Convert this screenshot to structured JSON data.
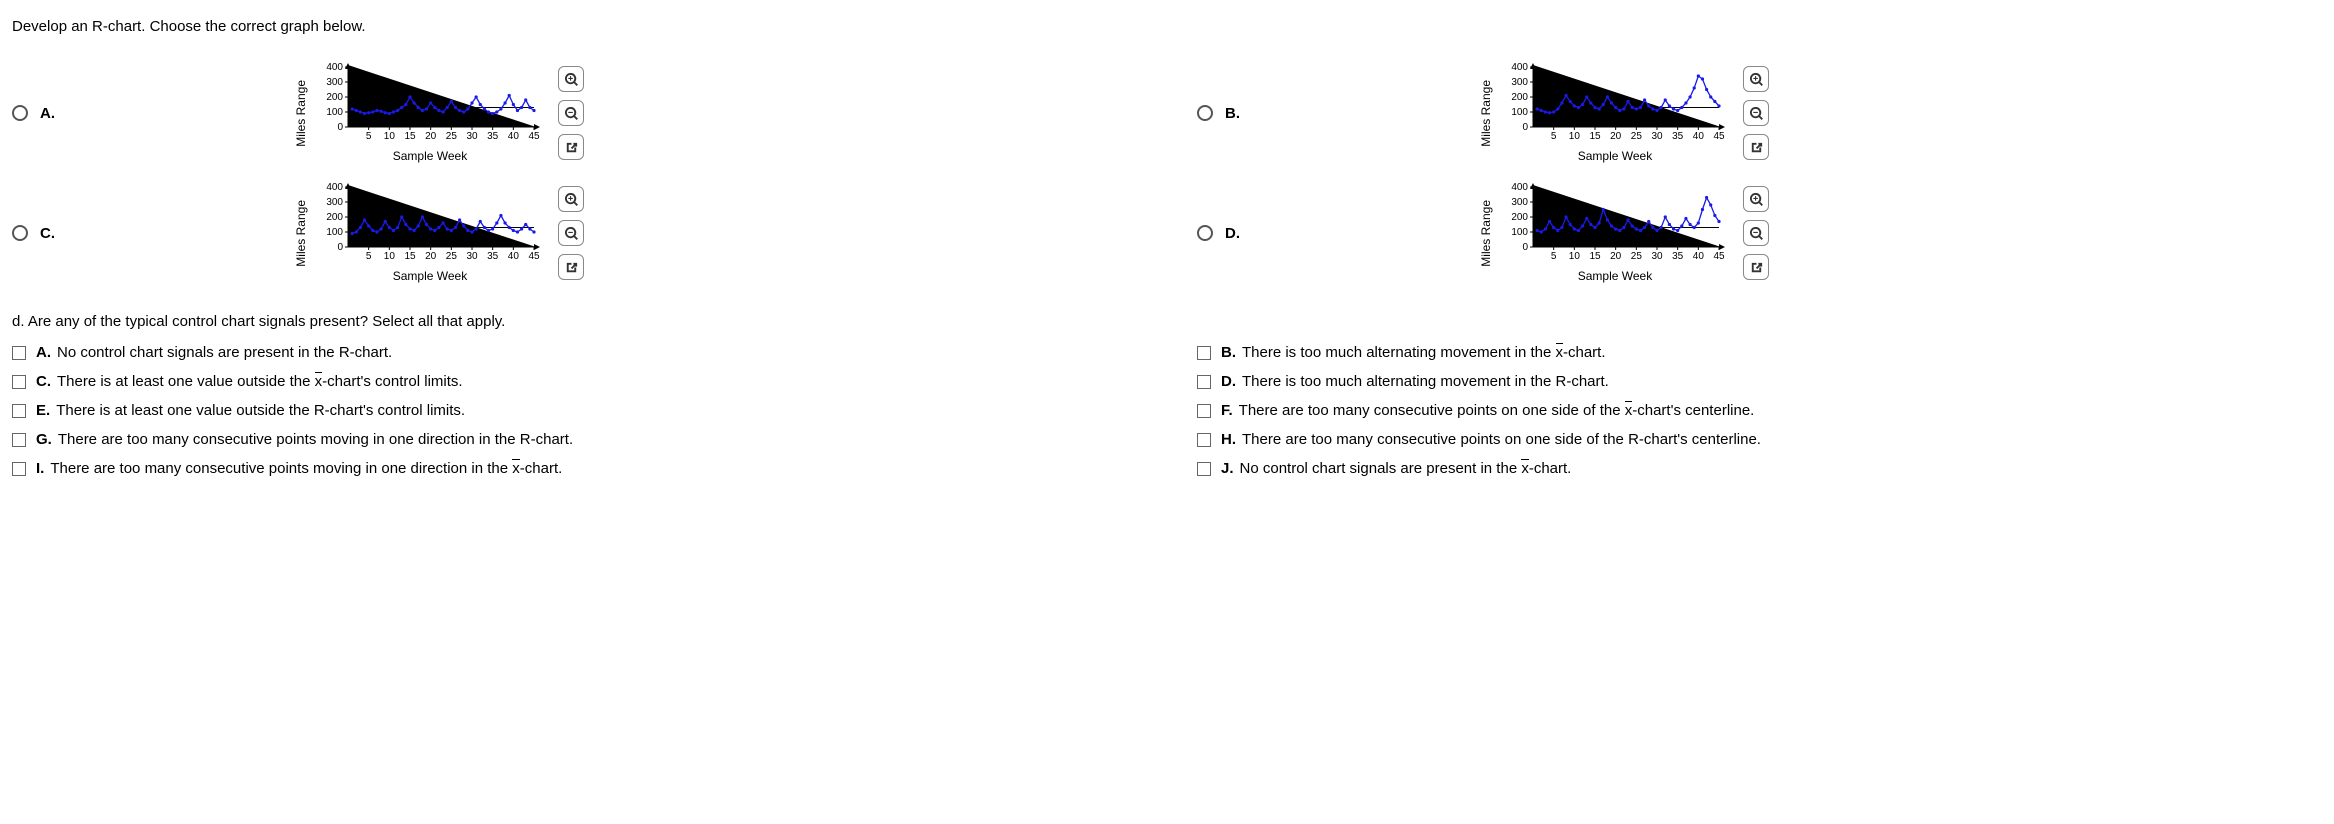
{
  "question_stem": "Develop an R-chart. Choose the correct graph below.",
  "sub_question": "d. Are any of the typical control chart signals present? Select all that apply.",
  "options": {
    "A": "A.",
    "B": "B.",
    "C": "C.",
    "D": "D."
  },
  "axis": {
    "ylabel": "Miles Range",
    "xlabel": "Sample Week",
    "xticks": [
      "5",
      "10",
      "15",
      "20",
      "25",
      "30",
      "35",
      "40",
      "45"
    ],
    "yticks": [
      "0",
      "100",
      "200",
      "300",
      "400"
    ]
  },
  "tools": {
    "zoom_in": "zoom-in-icon",
    "zoom_out": "zoom-out-icon",
    "pop_out": "pop-out-icon"
  },
  "checks": {
    "A": "No control chart signals are present in the R-chart.",
    "B": "There is too much alternating movement in the ",
    "B2": "-chart.",
    "C": "There is at least one value outside the ",
    "C2": "-chart's control limits.",
    "D": "There is too much alternating movement in the R-chart.",
    "E": "There is at least one value outside the R-chart's control limits.",
    "F": "There are too many consecutive points on one side of the ",
    "F2": "-chart's centerline.",
    "G": "There are too many consecutive points moving in one direction in the R-chart.",
    "H": "There are too many consecutive points on one side of the R-chart's centerline.",
    "I": "There are too many consecutive points moving in one direction in the ",
    "I2": "-chart.",
    "J": "No control chart signals are present in the ",
    "J2": "-chart."
  },
  "chart_data": [
    {
      "option": "A",
      "type": "line",
      "xlabel": "Sample Week",
      "ylabel": "Miles Range",
      "ylim": [
        0,
        400
      ],
      "x": [
        1,
        2,
        3,
        4,
        5,
        6,
        7,
        8,
        9,
        10,
        11,
        12,
        13,
        14,
        15,
        16,
        17,
        18,
        19,
        20,
        21,
        22,
        23,
        24,
        25,
        26,
        27,
        28,
        29,
        30,
        31,
        32,
        33,
        34,
        35,
        36,
        37,
        38,
        39,
        40,
        41,
        42,
        43,
        44,
        45
      ],
      "values": [
        120,
        110,
        100,
        90,
        95,
        100,
        110,
        105,
        95,
        90,
        100,
        110,
        130,
        150,
        200,
        160,
        130,
        110,
        120,
        160,
        130,
        110,
        100,
        130,
        170,
        130,
        110,
        100,
        120,
        160,
        200,
        150,
        120,
        100,
        90,
        100,
        120,
        160,
        210,
        150,
        110,
        130,
        180,
        130,
        110
      ],
      "control_lines": [
        130,
        0
      ]
    },
    {
      "option": "B",
      "type": "line",
      "xlabel": "Sample Week",
      "ylabel": "Miles Range",
      "ylim": [
        0,
        400
      ],
      "x": [
        1,
        2,
        3,
        4,
        5,
        6,
        7,
        8,
        9,
        10,
        11,
        12,
        13,
        14,
        15,
        16,
        17,
        18,
        19,
        20,
        21,
        22,
        23,
        24,
        25,
        26,
        27,
        28,
        29,
        30,
        31,
        32,
        33,
        34,
        35,
        36,
        37,
        38,
        39,
        40,
        41,
        42,
        43,
        44,
        45
      ],
      "values": [
        120,
        110,
        100,
        95,
        100,
        120,
        160,
        210,
        170,
        140,
        130,
        150,
        200,
        160,
        130,
        120,
        150,
        200,
        160,
        130,
        110,
        120,
        170,
        130,
        120,
        130,
        180,
        140,
        120,
        110,
        130,
        180,
        140,
        120,
        110,
        130,
        160,
        200,
        260,
        340,
        320,
        250,
        200,
        170,
        140
      ],
      "control_lines": [
        130,
        0
      ]
    },
    {
      "option": "C",
      "type": "line",
      "xlabel": "Sample Week",
      "ylabel": "Miles Range",
      "ylim": [
        0,
        400
      ],
      "x": [
        1,
        2,
        3,
        4,
        5,
        6,
        7,
        8,
        9,
        10,
        11,
        12,
        13,
        14,
        15,
        16,
        17,
        18,
        19,
        20,
        21,
        22,
        23,
        24,
        25,
        26,
        27,
        28,
        29,
        30,
        31,
        32,
        33,
        34,
        35,
        36,
        37,
        38,
        39,
        40,
        41,
        42,
        43,
        44,
        45
      ],
      "values": [
        90,
        100,
        130,
        180,
        140,
        110,
        100,
        120,
        170,
        130,
        110,
        130,
        200,
        150,
        120,
        110,
        140,
        200,
        150,
        120,
        110,
        130,
        160,
        120,
        110,
        130,
        180,
        140,
        110,
        100,
        120,
        170,
        130,
        110,
        120,
        160,
        210,
        160,
        130,
        110,
        100,
        120,
        150,
        120,
        100
      ],
      "control_lines": [
        130,
        0
      ]
    },
    {
      "option": "D",
      "type": "line",
      "xlabel": "Sample Week",
      "ylabel": "Miles Range",
      "ylim": [
        0,
        400
      ],
      "x": [
        1,
        2,
        3,
        4,
        5,
        6,
        7,
        8,
        9,
        10,
        11,
        12,
        13,
        14,
        15,
        16,
        17,
        18,
        19,
        20,
        21,
        22,
        23,
        24,
        25,
        26,
        27,
        28,
        29,
        30,
        31,
        32,
        33,
        34,
        35,
        36,
        37,
        38,
        39,
        40,
        41,
        42,
        43,
        44,
        45
      ],
      "values": [
        110,
        100,
        120,
        170,
        130,
        110,
        130,
        200,
        150,
        120,
        110,
        140,
        190,
        150,
        130,
        160,
        250,
        180,
        140,
        120,
        110,
        130,
        180,
        140,
        120,
        110,
        130,
        170,
        130,
        110,
        130,
        200,
        150,
        120,
        110,
        140,
        190,
        150,
        130,
        160,
        250,
        330,
        280,
        210,
        170
      ],
      "control_lines": [
        130,
        0
      ]
    }
  ]
}
